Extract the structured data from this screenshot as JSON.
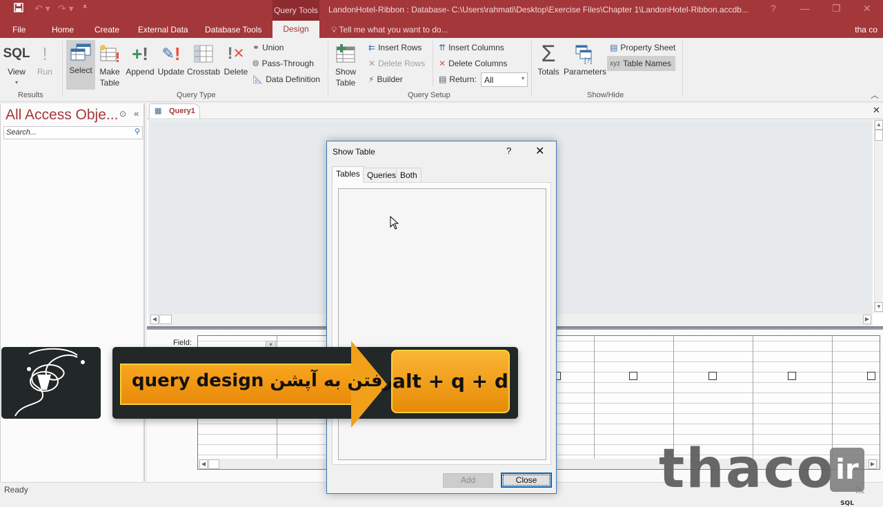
{
  "titlebar": {
    "context_tools": "Query Tools",
    "document_title": "LandonHotel-Ribbon : Database- C:\\Users\\rahmati\\Desktop\\Exercise Files\\Chapter 1\\LandonHotel-Ribbon.accdb...",
    "help": "?",
    "minimize": "—",
    "restore": "❐",
    "close": "✕"
  },
  "tabs": [
    {
      "label": "File"
    },
    {
      "label": "Home"
    },
    {
      "label": "Create"
    },
    {
      "label": "External Data"
    },
    {
      "label": "Database Tools"
    },
    {
      "label": "Design",
      "active": true
    }
  ],
  "tellme": "Tell me what you want to do...",
  "user": "tha co",
  "ribbon": {
    "results": {
      "label": "Results",
      "view": "View",
      "view_icon_text": "SQL",
      "run": "Run"
    },
    "query_type": {
      "label": "Query Type",
      "select": "Select",
      "make_table_1": "Make",
      "make_table_2": "Table",
      "append": "Append",
      "update": "Update",
      "crosstab": "Crosstab",
      "delete": "Delete",
      "union": "Union",
      "pass_through": "Pass-Through",
      "data_definition": "Data Definition"
    },
    "query_setup": {
      "label": "Query Setup",
      "show_table_1": "Show",
      "show_table_2": "Table",
      "insert_rows": "Insert Rows",
      "delete_rows": "Delete Rows",
      "builder": "Builder",
      "insert_columns": "Insert Columns",
      "delete_columns": "Delete Columns",
      "return_label": "Return:",
      "return_value": "All"
    },
    "show_hide": {
      "label": "Show/Hide",
      "totals": "Totals",
      "parameters": "Parameters",
      "property_sheet": "Property Sheet",
      "table_names": "Table Names"
    }
  },
  "nav": {
    "title": "All Access Obje...",
    "search_placeholder": "Search..."
  },
  "document": {
    "tab_label": "Query1",
    "field_label": "Field:"
  },
  "dialog": {
    "title": "Show Table",
    "help": "?",
    "close": "✕",
    "tabs": [
      "Tables",
      "Queries",
      "Both"
    ],
    "add": "Add",
    "close_button": "Close"
  },
  "overlay": {
    "instruction": "query design رفتن به آپشن",
    "shortcut": "alt + q + d"
  },
  "watermark": {
    "text": "thaco",
    "suffix": "ir",
    "sql": "SQL"
  },
  "status": "Ready"
}
